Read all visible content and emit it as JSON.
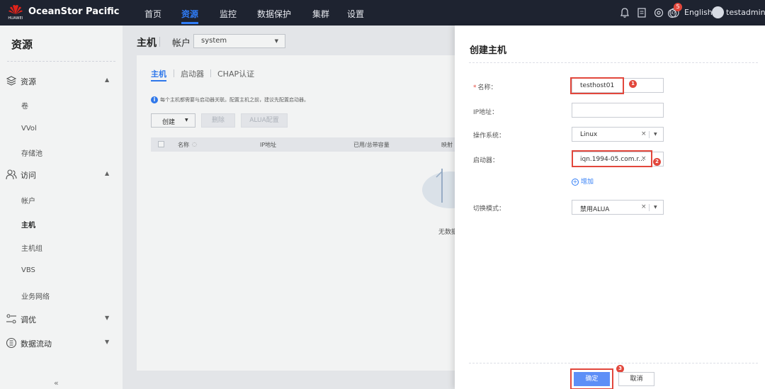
{
  "topbar": {
    "brand": "OceanStor Pacific",
    "logo_text": "HUAWEI",
    "nav": [
      "首页",
      "资源",
      "监控",
      "数据保护",
      "集群",
      "设置"
    ],
    "active_nav": "资源",
    "notification_count": "5",
    "language": "English",
    "user": "testadmin",
    "colors": {
      "bar": "#1e2330",
      "accent": "#2f7cf6"
    }
  },
  "sidebar": {
    "title": "资源",
    "groups": [
      {
        "label": "资源",
        "icon": "layers-icon",
        "expanded": true,
        "items": [
          "卷",
          "VVol",
          "存储池"
        ]
      },
      {
        "label": "访问",
        "icon": "users-icon",
        "expanded": true,
        "items": [
          "帐户",
          "主机",
          "主机组",
          "VBS",
          "业务网络"
        ]
      },
      {
        "label": "调优",
        "icon": "tuning-icon",
        "expanded": false,
        "items": []
      },
      {
        "label": "数据流动",
        "icon": "data-flow-icon",
        "expanded": false,
        "items": []
      }
    ],
    "active_item": "主机",
    "collapse_icon": "«"
  },
  "main": {
    "title": "主机",
    "account_label": "帐户",
    "account_value": "system",
    "tabs": [
      "主机",
      "启动器",
      "CHAP认证"
    ],
    "hint": "每个主机都需要与启动器关联。配置主机之前，建议先配置启动器。",
    "buttons": {
      "create": "创建",
      "delete": "删除",
      "alua": "ALUA配置"
    },
    "columns": [
      "名称",
      "IP地址",
      "已用/总带容量",
      "映射"
    ],
    "empty_text": "无数据"
  },
  "drawer": {
    "title": "创建主机",
    "fields": {
      "name": {
        "label": "名称：",
        "value": "testhost01",
        "required": true
      },
      "ip": {
        "label": "IP地址：",
        "value": ""
      },
      "os": {
        "label": "操作系统：",
        "value": "Linux"
      },
      "initiator": {
        "label": "启动器：",
        "value": "iqn.1994-05.com.r..."
      },
      "switch_mode": {
        "label": "切换模式：",
        "value": "禁用ALUA"
      }
    },
    "add_label": "增加",
    "ok": "确定",
    "cancel": "取消",
    "steps": [
      "1",
      "2",
      "3"
    ],
    "highlight_color": "#e2473c"
  }
}
